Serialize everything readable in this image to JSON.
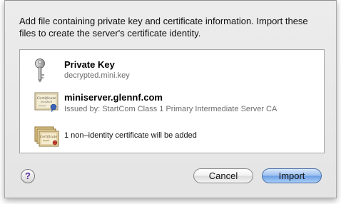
{
  "dialog": {
    "message": "Add file containing private key and certificate information.  Import these files to create the server's certificate identity."
  },
  "items": [
    {
      "icon": "key-icon",
      "title": "Private Key",
      "subtitle": "decrypted.mini.key"
    },
    {
      "icon": "certificate-icon",
      "title": "miniserver.glennf.com",
      "subtitle": "Issued by: StartCom Class 1 Primary Intermediate Server CA"
    },
    {
      "icon": "certificates-stack-icon",
      "text": "1 non–identity certificate will be added"
    }
  ],
  "buttons": {
    "help_label": "?",
    "cancel_label": "Cancel",
    "import_label": "Import"
  },
  "colors": {
    "import_button": "#7fb0ec",
    "help_glyph": "#5a2f9b"
  }
}
